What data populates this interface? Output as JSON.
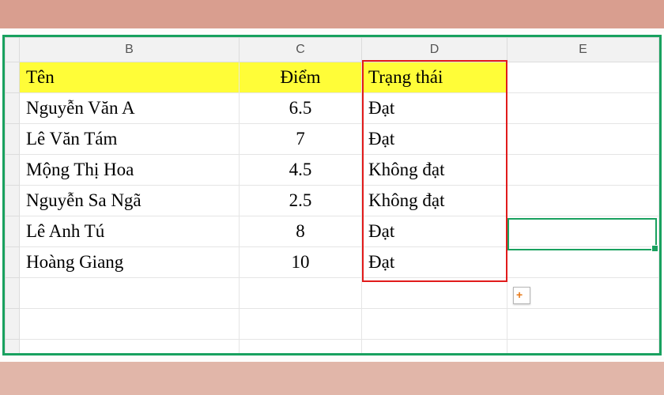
{
  "columns": {
    "b": "B",
    "c": "C",
    "d": "D",
    "e": "E"
  },
  "headers": {
    "name": "Tên",
    "score": "Điểm",
    "status": "Trạng thái"
  },
  "rows": [
    {
      "name": "Nguyễn Văn A",
      "score": "6.5",
      "status": "Đạt"
    },
    {
      "name": "Lê Văn Tám",
      "score": "7",
      "status": "Đạt"
    },
    {
      "name": "Mộng Thị Hoa",
      "score": "4.5",
      "status": "Không đạt"
    },
    {
      "name": "Nguyễn Sa Ngã",
      "score": "2.5",
      "status": "Không đạt"
    },
    {
      "name": "Lê Anh Tú",
      "score": "8",
      "status": "Đạt"
    },
    {
      "name": "Hoàng Giang",
      "score": "10",
      "status": "Đạt"
    }
  ],
  "chart_data": {
    "type": "table",
    "title": "",
    "columns": [
      "Tên",
      "Điểm",
      "Trạng thái"
    ],
    "data": [
      [
        "Nguyễn Văn A",
        6.5,
        "Đạt"
      ],
      [
        "Lê Văn Tám",
        7,
        "Đạt"
      ],
      [
        "Mộng Thị Hoa",
        4.5,
        "Không đạt"
      ],
      [
        "Nguyễn Sa Ngã",
        2.5,
        "Không đạt"
      ],
      [
        "Lê Anh Tú",
        8,
        "Đạt"
      ],
      [
        "Hoàng Giang",
        10,
        "Đạt"
      ]
    ]
  }
}
